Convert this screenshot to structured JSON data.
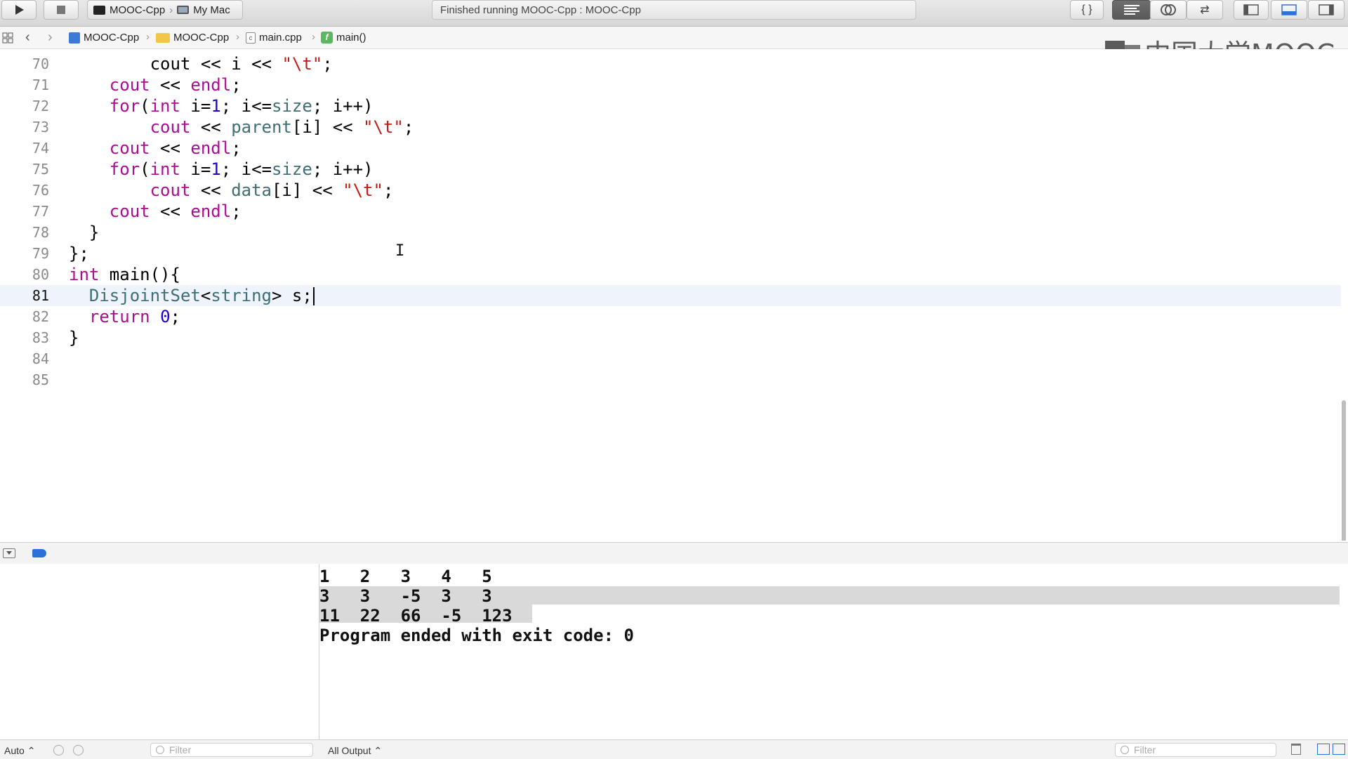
{
  "toolbar": {
    "scheme_project": "MOOC-Cpp",
    "scheme_destination": "My Mac",
    "activity_status": "Finished running MOOC-Cpp : MOOC-Cpp",
    "run_icon": "play-icon",
    "stop_icon": "stop-icon",
    "editor_modes": [
      "standard-editor-icon",
      "assistant-editor-icon",
      "version-editor-icon"
    ],
    "panel_toggles": [
      "navigator-toggle-icon",
      "debug-area-toggle-icon",
      "utilities-toggle-icon"
    ]
  },
  "jumpbar": {
    "crumbs": [
      "MOOC-Cpp",
      "MOOC-Cpp",
      "main.cpp",
      "main()"
    ]
  },
  "watermark": {
    "text": "中国大学MOOC"
  },
  "editor": {
    "line_numbers": [
      "70",
      "71",
      "72",
      "73",
      "74",
      "75",
      "76",
      "77",
      "78",
      "79",
      "80",
      "81",
      "82",
      "83",
      "84",
      "85"
    ],
    "current_line": "81",
    "lines": [
      "            cout << i << \"\\t\";",
      "        cout << endl;",
      "        for(int i=1; i<=size; i++)",
      "            cout << parent[i] << \"\\t\";",
      "        cout << endl;",
      "        for(int i=1; i<=size; i++)",
      "            cout << data[i] << \"\\t\";",
      "        cout << endl;",
      "    }",
      "};",
      "int main(){",
      "    DisjointSet<string> s;",
      "    return 0;",
      "}",
      "",
      ""
    ]
  },
  "console": {
    "output": [
      "1   2   3   4   5",
      "3   3   -5  3   3",
      "11  22  66  -5  123",
      "Program ended with exit code: 0"
    ]
  },
  "bottombar": {
    "variables_scope": "Auto ⌃",
    "variables_filter_placeholder": "Filter",
    "console_scope": "All Output ⌃",
    "console_filter_placeholder": "Filter"
  },
  "colors": {
    "keyword": "#aa0d91",
    "number": "#1c00cf",
    "string": "#c41a16",
    "identifier": "#3f6e74",
    "current_line_bg": "#eef3fc"
  }
}
